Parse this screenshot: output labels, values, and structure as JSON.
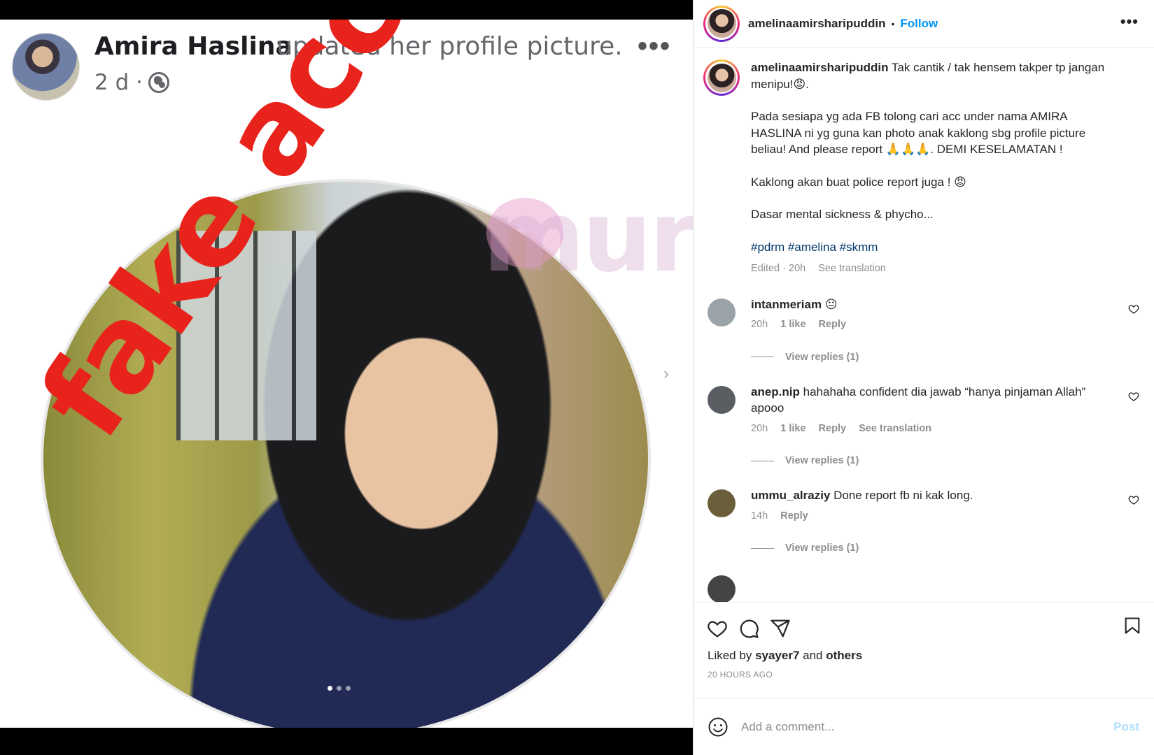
{
  "facebook": {
    "name": "Amira Haslina",
    "action": "updated her profile picture.",
    "more": "•••",
    "time": "2 d ·",
    "overlay_text": "fake account!!",
    "watermark": "muroi"
  },
  "carousel": {
    "slides": 3,
    "active": 1
  },
  "header": {
    "username": "amelinaamirsharipuddin",
    "separator": "•",
    "follow": "Follow",
    "more": "•••"
  },
  "caption": {
    "username": "amelinaamirsharipuddin",
    "line1": "Tak cantik / tak hensem takper tp jangan menipu!😡.",
    "para2": "Pada sesiapa yg ada FB tolong cari acc under nama AMIRA HASLINA ni yg guna kan photo anak kaklong sbg profile picture beliau! And please report 🙏🙏🙏. DEMI KESELAMATAN !",
    "para3": "Kaklong akan buat police report juga ! 😡",
    "para4": "Dasar mental sickness & phycho...",
    "hashtags": "#pdrm #amelina #skmm",
    "edited": "Edited · 20h",
    "see_translation": "See translation"
  },
  "comments": [
    {
      "username": "intanmeriam",
      "text": "😐",
      "time": "20h",
      "likes": "1 like",
      "reply": "Reply",
      "translate": "",
      "view_replies": "View replies (1)",
      "avatar_color": "#9aa3a8"
    },
    {
      "username": "anep.nip",
      "text": "hahahaha confident dia jawab “hanya pinjaman Allah” apooo",
      "time": "20h",
      "likes": "1 like",
      "reply": "Reply",
      "translate": "See translation",
      "view_replies": "View replies (1)",
      "avatar_color": "#5a5e63"
    },
    {
      "username": "ummu_alraziy",
      "text": "Done report fb ni kak long.",
      "time": "14h",
      "likes": "",
      "reply": "Reply",
      "translate": "",
      "view_replies": "View replies (1)",
      "avatar_color": "#6b5e3a"
    }
  ],
  "actions": {
    "liked_prefix": "Liked by",
    "liked_user": "syayer7",
    "liked_and": "and",
    "liked_others": "others",
    "ago": "20 HOURS AGO"
  },
  "add_comment": {
    "placeholder": "Add a comment...",
    "post": "Post"
  },
  "colors": {
    "accent": "#0095f6",
    "link": "#00376b",
    "muted": "#8e8e8e",
    "overlay_red": "#e8231c"
  }
}
